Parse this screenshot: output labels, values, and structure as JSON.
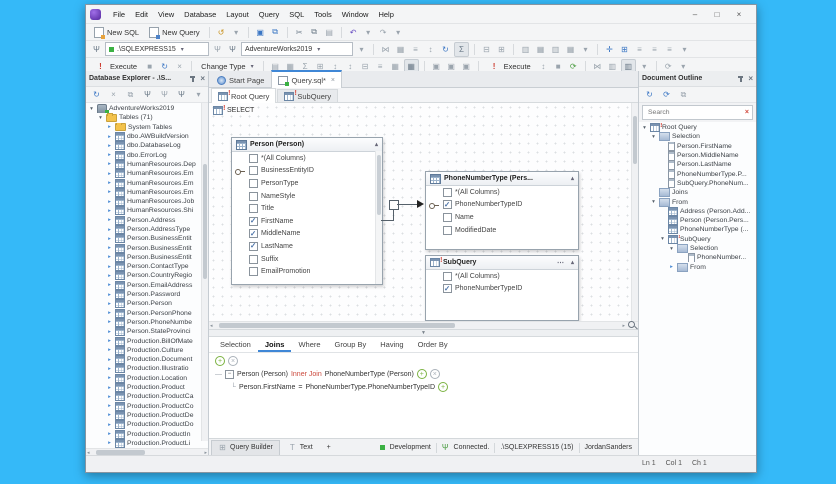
{
  "titlebar": {
    "menus": [
      "File",
      "Edit",
      "View",
      "Database",
      "Layout",
      "Query",
      "SQL",
      "Tools",
      "Window",
      "Help"
    ],
    "minimize": "–",
    "maximize": "□",
    "close": "×"
  },
  "toolbar_main": {
    "new_sql": "New SQL",
    "new_query": "New Query"
  },
  "toolbar_connection": {
    "server": ".\\SQLEXPRESS15",
    "database": "AdventureWorks2019"
  },
  "toolbar_query": {
    "execute": "Execute",
    "change_type": "Change Type",
    "execute2": "Execute"
  },
  "explorer": {
    "title": "Database Explorer - .\\S...",
    "items": [
      {
        "label": "AdventureWorks2019",
        "cls": "lvl0 ae ic-db"
      },
      {
        "label": "Tables (71)",
        "cls": "lvl1 ae ic-folder"
      },
      {
        "label": "System Tables",
        "cls": "lvl2 ac ic-folder"
      },
      {
        "label": "dbo.AWBuildVersion",
        "cls": "lvl2 ac ic-table"
      },
      {
        "label": "dbo.DatabaseLog",
        "cls": "lvl2 ac ic-table"
      },
      {
        "label": "dbo.ErrorLog",
        "cls": "lvl2 ac ic-table"
      },
      {
        "label": "HumanResources.Dep",
        "cls": "lvl2 ac ic-table"
      },
      {
        "label": "HumanResources.Em",
        "cls": "lvl2 ac ic-table"
      },
      {
        "label": "HumanResources.Em",
        "cls": "lvl2 ac ic-table"
      },
      {
        "label": "HumanResources.Em",
        "cls": "lvl2 ac ic-table"
      },
      {
        "label": "HumanResources.Job",
        "cls": "lvl2 ac ic-table"
      },
      {
        "label": "HumanResources.Shi",
        "cls": "lvl2 ac ic-table"
      },
      {
        "label": "Person.Address",
        "cls": "lvl2 ac ic-table"
      },
      {
        "label": "Person.AddressType",
        "cls": "lvl2 ac ic-table"
      },
      {
        "label": "Person.BusinessEntit",
        "cls": "lvl2 ac ic-table"
      },
      {
        "label": "Person.BusinessEntit",
        "cls": "lvl2 ac ic-table"
      },
      {
        "label": "Person.BusinessEntit",
        "cls": "lvl2 ac ic-table"
      },
      {
        "label": "Person.ContactType",
        "cls": "lvl2 ac ic-table"
      },
      {
        "label": "Person.CountryRegio",
        "cls": "lvl2 ac ic-table"
      },
      {
        "label": "Person.EmailAddress",
        "cls": "lvl2 ac ic-table"
      },
      {
        "label": "Person.Password",
        "cls": "lvl2 ac ic-table"
      },
      {
        "label": "Person.Person",
        "cls": "lvl2 ac ic-table"
      },
      {
        "label": "Person.PersonPhone",
        "cls": "lvl2 ac ic-table"
      },
      {
        "label": "Person.PhoneNumbe",
        "cls": "lvl2 ac ic-table"
      },
      {
        "label": "Person.StateProvinci",
        "cls": "lvl2 ac ic-table"
      },
      {
        "label": "Production.BillOfMate",
        "cls": "lvl2 ac ic-table"
      },
      {
        "label": "Production.Culture",
        "cls": "lvl2 ac ic-table"
      },
      {
        "label": "Production.Document",
        "cls": "lvl2 ac ic-table"
      },
      {
        "label": "Production.Illustratio",
        "cls": "lvl2 ac ic-table"
      },
      {
        "label": "Production.Location",
        "cls": "lvl2 ac ic-table"
      },
      {
        "label": "Production.Product",
        "cls": "lvl2 ac ic-table"
      },
      {
        "label": "Production.ProductCa",
        "cls": "lvl2 ac ic-table"
      },
      {
        "label": "Production.ProductCo",
        "cls": "lvl2 ac ic-table"
      },
      {
        "label": "Production.ProductDe",
        "cls": "lvl2 ac ic-table"
      },
      {
        "label": "Production.ProductDo",
        "cls": "lvl2 ac ic-table"
      },
      {
        "label": "Production.ProductIn",
        "cls": "lvl2 ac ic-table"
      },
      {
        "label": "Production.ProductLi",
        "cls": "lvl2 ac ic-table"
      }
    ]
  },
  "doc_tabs": {
    "start_page": "Start Page",
    "query_file": "Query.sql*"
  },
  "designer": {
    "tab_root": "Root Query",
    "tab_sub": "SubQuery",
    "select_label": "SELECT",
    "person": {
      "title": "Person (Person)",
      "columns": [
        {
          "name": "*(All Columns)",
          "cls": ""
        },
        {
          "name": "BusinessEntityID",
          "cls": "haskey"
        },
        {
          "name": "PersonType",
          "cls": ""
        },
        {
          "name": "NameStyle",
          "cls": ""
        },
        {
          "name": "Title",
          "cls": ""
        },
        {
          "name": "FirstName",
          "cls": "checked"
        },
        {
          "name": "MiddleName",
          "cls": "checked"
        },
        {
          "name": "LastName",
          "cls": "checked"
        },
        {
          "name": "Suffix",
          "cls": ""
        },
        {
          "name": "EmailPromotion",
          "cls": ""
        }
      ]
    },
    "phone": {
      "title": "PhoneNumberType  (Pers...",
      "columns": [
        {
          "name": "*(All Columns)",
          "cls": ""
        },
        {
          "name": "PhoneNumberTypeID",
          "cls": "haskey checked"
        },
        {
          "name": "Name",
          "cls": ""
        },
        {
          "name": "ModifiedDate",
          "cls": ""
        }
      ]
    },
    "subquery": {
      "title": "SubQuery",
      "dots": "...",
      "columns": [
        {
          "name": "*(All Columns)",
          "cls": ""
        },
        {
          "name": "PhoneNumberTypeID",
          "cls": "checked"
        }
      ]
    }
  },
  "criteria": {
    "tabs": [
      {
        "label": "Selection",
        "cls": ""
      },
      {
        "label": "Joins",
        "cls": "active"
      },
      {
        "label": "Where",
        "cls": ""
      },
      {
        "label": "Group By",
        "cls": ""
      },
      {
        "label": "Having",
        "cls": ""
      },
      {
        "label": "Order By",
        "cls": ""
      }
    ],
    "join": {
      "left": "Person (Person)",
      "keyword": "Inner Join",
      "right": "PhoneNumberType (Person)"
    },
    "condition": {
      "left": "Person.FirstName",
      "op": "=",
      "right": "PhoneNumberType.PhoneNumberTypeID"
    }
  },
  "bottom": {
    "query_builder": "Query Builder",
    "text": "Text",
    "add": "+",
    "env": "Development",
    "connected": "Connected.",
    "server": ".\\SQLEXPRESS15 (15)",
    "user": "JordanSanders"
  },
  "statusbar": {
    "ln": "Ln 1",
    "col": "Col 1",
    "ch": "Ch 1"
  },
  "outline": {
    "title": "Document Outline",
    "search_placeholder": "Search",
    "items": [
      {
        "label": "Root Query",
        "cls": "lvl0 ae ic-query"
      },
      {
        "label": "Selection",
        "cls": "lvl1 ae ic-clause"
      },
      {
        "label": "Person.FirstName",
        "cls": "lvl2 ic-column"
      },
      {
        "label": "Person.MiddleName",
        "cls": "lvl2 ic-column"
      },
      {
        "label": "Person.LastName",
        "cls": "lvl2 ic-column"
      },
      {
        "label": "PhoneNumberType.P...",
        "cls": "lvl2 ic-column"
      },
      {
        "label": "SubQuery.PhoneNum...",
        "cls": "lvl2 ic-column"
      },
      {
        "label": "Joins",
        "cls": "lvl1 ic-clause"
      },
      {
        "label": "From",
        "cls": "lvl1 ae ic-clause"
      },
      {
        "label": "Address (Person.Add...",
        "cls": "lvl2 ic-table"
      },
      {
        "label": "Person (Person.Pers...",
        "cls": "lvl2 ic-table"
      },
      {
        "label": "PhoneNumberType (...",
        "cls": "lvl2 ic-table"
      },
      {
        "label": "SubQuery",
        "cls": "lvl2 ae ic-query"
      },
      {
        "label": "Selection",
        "cls": "lvl3 ae ic-clause"
      },
      {
        "label": "PhoneNumber...",
        "cls": "lvl4 ic-column"
      },
      {
        "label": "From",
        "cls": "lvl3 ac ic-clause"
      }
    ]
  },
  "glyphs": {
    "undo_small": "↺",
    "save": "▣",
    "save_all": "⧉",
    "cut": "✂",
    "copy": "⧉",
    "paste": "▤",
    "undo": "↶",
    "redo": "↷",
    "dropdown": "▾",
    "plug": "Ψ",
    "refresh": "↻",
    "cancel": "×",
    "stop": "■",
    "bang": "!",
    "join": "⋈",
    "grid": "▦",
    "list": "≡",
    "sort": "↕",
    "fit": "⊞",
    "shrink": "⊟",
    "layout": "▥",
    "pan": "✛",
    "text_t": "T",
    "sigma": "Σ",
    "gear": "⟳",
    "more": "⋯",
    "collapse_up": "▴",
    "chev": "▾"
  }
}
